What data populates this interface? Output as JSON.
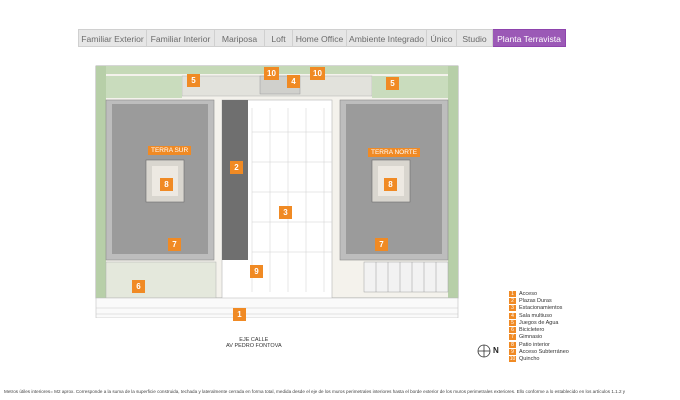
{
  "tabs": [
    {
      "label": "Familiar Exterior",
      "active": false
    },
    {
      "label": "Familiar Interior",
      "active": false
    },
    {
      "label": "Mariposa",
      "active": false
    },
    {
      "label": "Loft",
      "active": false
    },
    {
      "label": "Home Office",
      "active": false
    },
    {
      "label": "Ambiente Integrado",
      "active": false
    },
    {
      "label": "Único",
      "active": false
    },
    {
      "label": "Studio",
      "active": false
    },
    {
      "label": "Planta Terravista",
      "active": true
    }
  ],
  "plan": {
    "tower_south": "TERRA SUR",
    "tower_north": "TERRA NORTE",
    "badges": [
      "10",
      "4",
      "10",
      "5",
      "5",
      "2",
      "8",
      "8",
      "3",
      "7",
      "7",
      "9",
      "6",
      "1"
    ]
  },
  "street": {
    "line1": "EJE CALLE",
    "line2": "AV PEDRO FONTOVA"
  },
  "north_label": "N",
  "legend": [
    {
      "num": "1",
      "text": "Acceso"
    },
    {
      "num": "2",
      "text": "Plazas Duras"
    },
    {
      "num": "3",
      "text": "Estacionamientos"
    },
    {
      "num": "4",
      "text": "Sala multiuso"
    },
    {
      "num": "5",
      "text": "Juegos de Agua"
    },
    {
      "num": "6",
      "text": "Bicicletero"
    },
    {
      "num": "7",
      "text": "Gimnasio"
    },
    {
      "num": "8",
      "text": "Patio interior"
    },
    {
      "num": "9",
      "text": "Acceso Subterráneo"
    },
    {
      "num": "10",
      "text": "Quincho"
    }
  ],
  "footnote": "Metros útiles interiores= M2 aprox. Corresponde a la suma de la superficie construida, techada y lateralmente cerrada en forma total, medida desde el eje de los muros perimetrales interiores hasta el borde exterior de los muros perimetrales exteriores. Ello conforme a lo establecido en los artículos 1.1.2 y",
  "colors": {
    "accent_orange": "#f08a24",
    "active_tab": "#9b59b6",
    "tower_gray": "#8c8c8c",
    "grass_green": "#a8c69a"
  }
}
